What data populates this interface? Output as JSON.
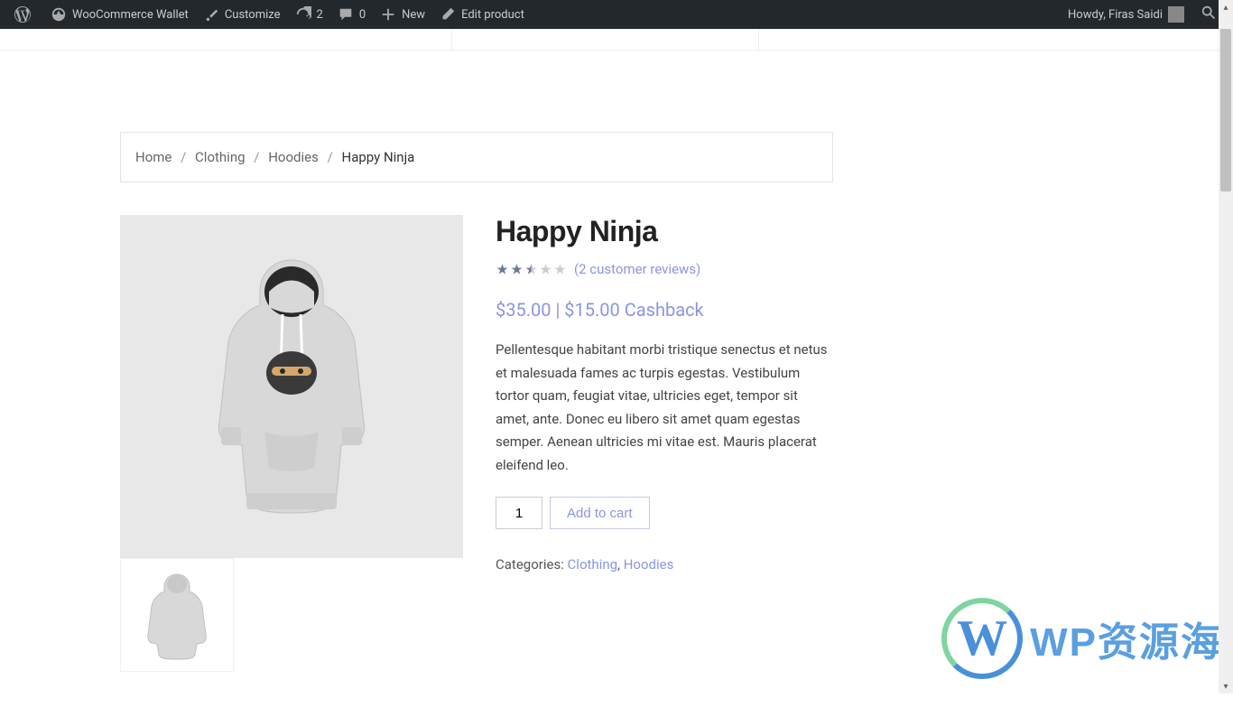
{
  "adminbar": {
    "site_name": "WooCommerce Wallet",
    "customize": "Customize",
    "updates_count": "2",
    "comments_count": "0",
    "new_label": "New",
    "edit_label": "Edit product",
    "howdy": "Howdy, Firas Saidi"
  },
  "breadcrumb": {
    "home": "Home",
    "level1": "Clothing",
    "level2": "Hoodies",
    "current": "Happy Ninja"
  },
  "product": {
    "title": "Happy Ninja",
    "reviews_link": "(2 customer reviews)",
    "price": "$35.00",
    "cashback": "$15.00 Cashback",
    "description": "Pellentesque habitant morbi tristique senectus et netus et malesuada fames ac turpis egestas. Vestibulum tortor quam, feugiat vitae, ultricies eget, tempor sit amet, ante. Donec eu libero sit amet quam egestas semper. Aenean ultricies mi vitae est. Mauris placerat eleifend leo.",
    "quantity": "1",
    "add_to_cart": "Add to cart",
    "categories_label": "Categories: ",
    "category1": "Clothing",
    "category2": "Hoodies",
    "rating_stars": 2.5,
    "rating_max": 5
  },
  "watermark": {
    "text": "WP资源海"
  }
}
